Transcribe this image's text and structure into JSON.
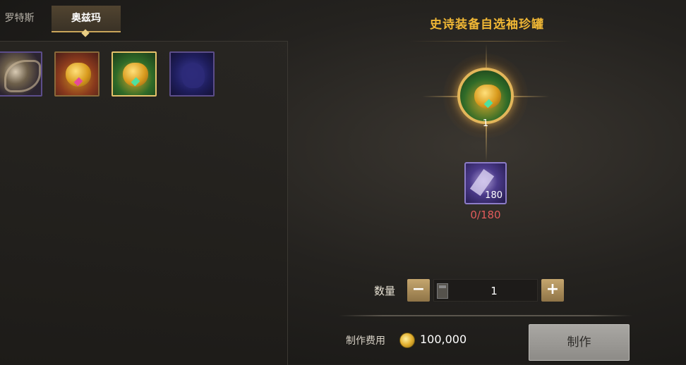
{
  "tabs": [
    {
      "label": "罗特斯",
      "active": false
    },
    {
      "label": "奥兹玛",
      "active": true
    }
  ],
  "items": [
    {
      "icon": "feather-creature-icon",
      "border": "purple"
    },
    {
      "icon": "red-gold-pot-icon",
      "border": "gold"
    },
    {
      "icon": "green-gold-pot-icon",
      "border": "gold",
      "selected": true
    },
    {
      "icon": "blue-ghost-icon",
      "border": "purple"
    }
  ],
  "recipe": {
    "title": "史诗装备自选袖珍罐",
    "result_count": "1",
    "material_count": "180",
    "material_progress": "0/180"
  },
  "quantity": {
    "label": "数量",
    "minus": "−",
    "plus": "+",
    "value": "1"
  },
  "cost": {
    "label": "制作费用",
    "value": "100,000",
    "currency_icon": "gold-coin-icon"
  },
  "craft_button": "制作",
  "colors": {
    "title": "#f0b735",
    "progress_insufficient": "#e25b5b",
    "accent_gold": "#c9a55a"
  }
}
